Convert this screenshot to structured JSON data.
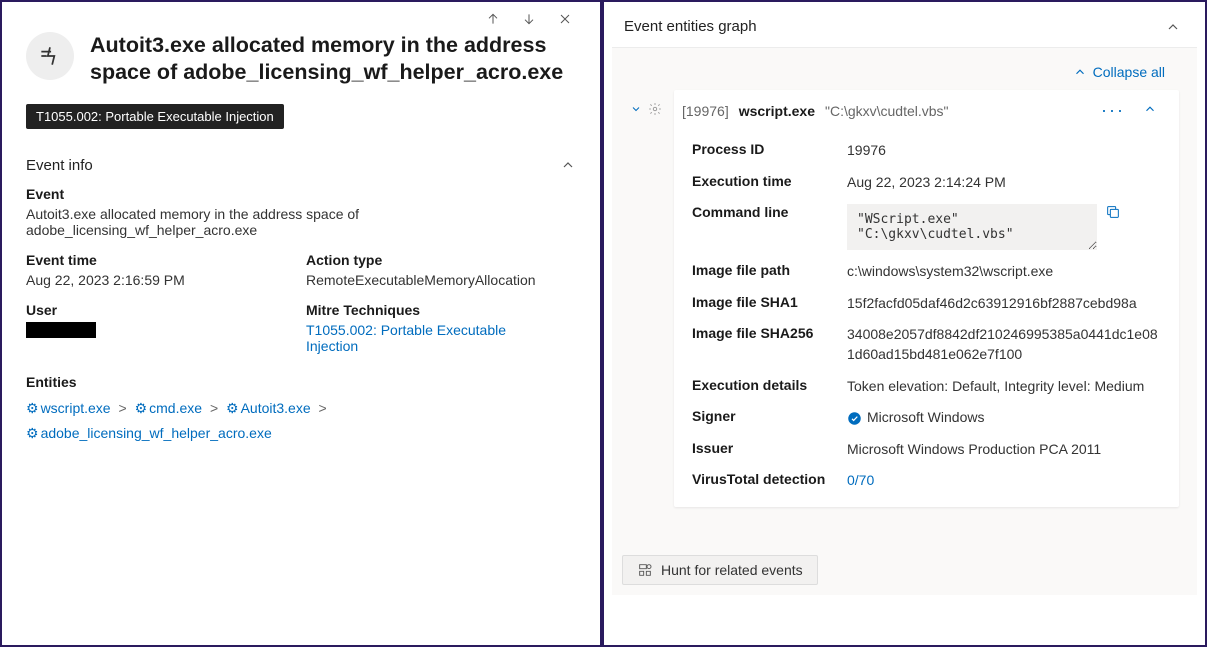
{
  "left": {
    "title": "Autoit3.exe allocated memory in the address space of adobe_licensing_wf_helper_acro.exe",
    "mitre_tag": "T1055.002: Portable Executable Injection",
    "event_info_header": "Event info",
    "event_label": "Event",
    "event_text": "Autoit3.exe allocated memory in the address space of adobe_licensing_wf_helper_acro.exe",
    "event_time_label": "Event time",
    "event_time": "Aug 22, 2023 2:16:59 PM",
    "action_type_label": "Action type",
    "action_type": "RemoteExecutableMemoryAllocation",
    "user_label": "User",
    "mitre_tech_label": "Mitre Techniques",
    "mitre_tech_link": "T1055.002: Portable Executable Injection",
    "entities_label": "Entities",
    "entities": [
      "wscript.exe",
      "cmd.exe",
      "Autoit3.exe",
      "adobe_licensing_wf_helper_acro.exe"
    ]
  },
  "right": {
    "header": "Event entities graph",
    "collapse_all": "Collapse all",
    "node": {
      "pid_bracket": "[19976]",
      "name": "wscript.exe",
      "args": "\"C:\\gkxv\\cudtel.vbs\"",
      "process_id_label": "Process ID",
      "process_id": "19976",
      "exec_time_label": "Execution time",
      "exec_time": "Aug 22, 2023 2:14:24 PM",
      "cmd_label": "Command line",
      "cmd": "\"WScript.exe\"\n\"C:\\gkxv\\cudtel.vbs\"",
      "img_path_label": "Image file path",
      "img_path": "c:\\windows\\system32\\wscript.exe",
      "sha1_label": "Image file SHA1",
      "sha1": "15f2facfd05daf46d2c63912916bf2887cebd98a",
      "sha256_label": "Image file SHA256",
      "sha256": "34008e2057df8842df210246995385a0441dc1e081d60ad15bd481e062e7f100",
      "exec_det_label": "Execution details",
      "exec_det": "Token elevation: Default, Integrity level: Medium",
      "signer_label": "Signer",
      "signer": "Microsoft Windows",
      "issuer_label": "Issuer",
      "issuer": "Microsoft Windows Production PCA 2011",
      "vt_label": "VirusTotal detection",
      "vt": "0/70"
    },
    "hunt_button": "Hunt for related events"
  }
}
